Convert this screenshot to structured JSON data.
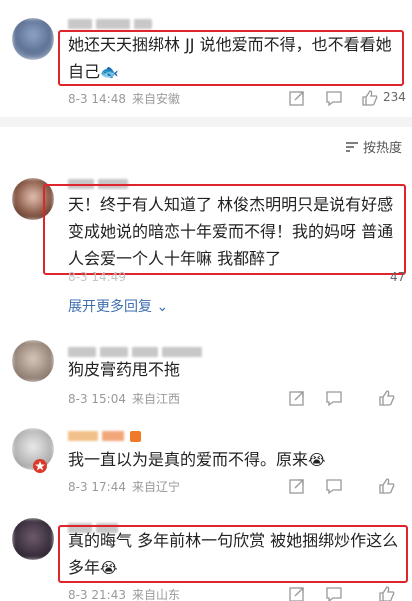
{
  "sort": {
    "label": "按热度"
  },
  "expand_label": "展开更多回复",
  "comments": [
    {
      "text": "她还天天捆绑林 JJ 说他爱而不得，也不看看她自己",
      "time": "8-3 14:48",
      "location": "来自安徽",
      "likes": "234"
    },
    {
      "text": "天！终于有人知道了 林俊杰明明只是说有好感 变成她说的暗恋十年爱而不得！我的妈呀 普通人会爱一个人十年嘛 我都醉了",
      "time": "8-3 14:49",
      "location": "",
      "likes": "47"
    },
    {
      "text": "狗皮膏药甩不拖",
      "time": "8-3 15:04",
      "location": "来自江西",
      "likes": ""
    },
    {
      "text": "我一直以为是真的爱而不得。原来",
      "time": "8-3 17:44",
      "location": "来自辽宁",
      "likes": ""
    },
    {
      "text": "真的晦气 多年前林一句欣赏 被她捆绑炒作这么多年",
      "time": "8-3 21:43",
      "location": "来自山东",
      "likes": ""
    }
  ],
  "colors": {
    "highlight": "#e0242c",
    "link": "#3f6fb0",
    "muted": "#9a9a9a"
  }
}
